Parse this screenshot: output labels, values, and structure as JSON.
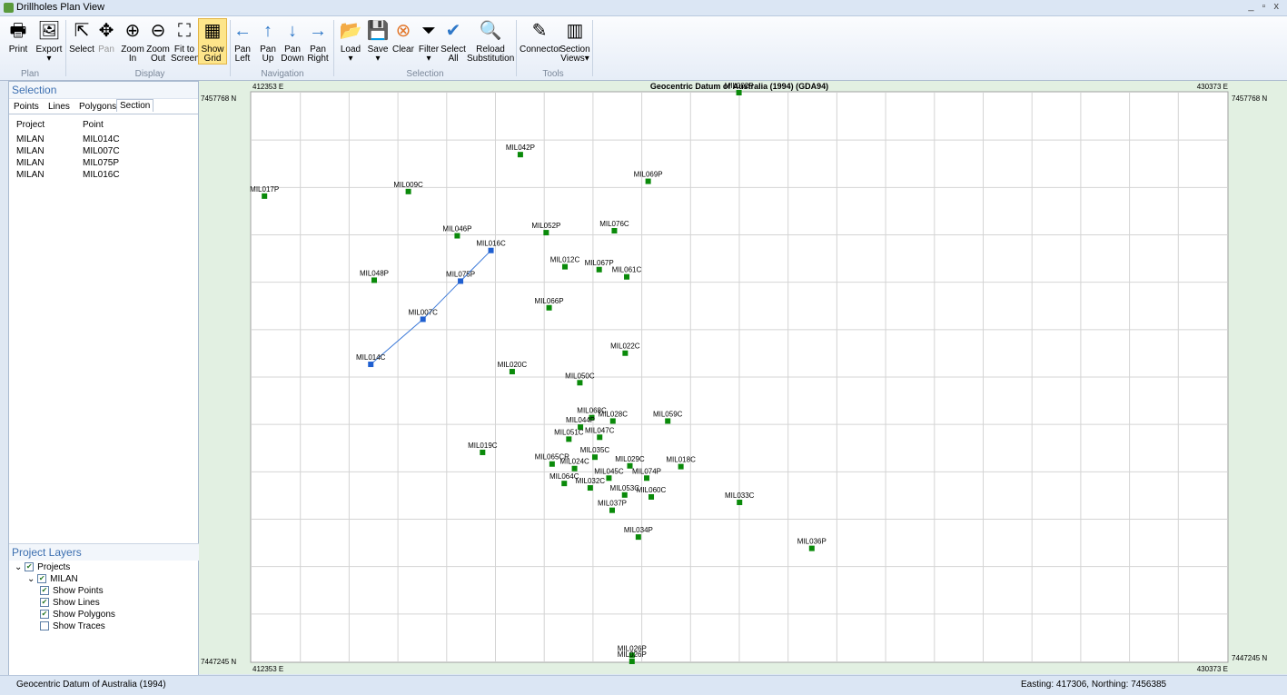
{
  "window": {
    "title": "Drillholes Plan View",
    "controls": "_ ▫ x"
  },
  "ribbon": {
    "buttons": [
      {
        "id": "print",
        "label": "Print",
        "icon": "🖶"
      },
      {
        "id": "export",
        "label": "Export\n▾",
        "icon": "🖼"
      },
      {
        "id": "select",
        "label": "Select",
        "icon": "⇱"
      },
      {
        "id": "pan",
        "label": "Pan",
        "icon": "✥"
      },
      {
        "id": "zoom_in",
        "label": "Zoom\nIn",
        "icon": "⊕"
      },
      {
        "id": "zoom_out",
        "label": "Zoom\nOut",
        "icon": "⊖"
      },
      {
        "id": "fit",
        "label": "Fit to\nScreen",
        "icon": "⛶"
      },
      {
        "id": "grid",
        "label": "Show\nGrid",
        "icon": "▦"
      },
      {
        "id": "pan_left",
        "label": "Pan\nLeft",
        "icon": "←"
      },
      {
        "id": "pan_up",
        "label": "Pan\nUp",
        "icon": "↑"
      },
      {
        "id": "pan_down",
        "label": "Pan\nDown",
        "icon": "↓"
      },
      {
        "id": "pan_right",
        "label": "Pan\nRight",
        "icon": "→"
      },
      {
        "id": "load",
        "label": "Load\n▾",
        "icon": "📂"
      },
      {
        "id": "save",
        "label": "Save\n▾",
        "icon": "💾"
      },
      {
        "id": "clear",
        "label": "Clear",
        "icon": "⊗"
      },
      {
        "id": "filter",
        "label": "Filter\n▾",
        "icon": "⏷"
      },
      {
        "id": "select_all",
        "label": "Select\nAll",
        "icon": "✔"
      },
      {
        "id": "reload",
        "label": "Reload\nSubstitution",
        "icon": "🔍"
      },
      {
        "id": "connector",
        "label": "Connector",
        "icon": "✎"
      },
      {
        "id": "section",
        "label": "Section\nViews▾",
        "icon": "▥"
      }
    ],
    "groups": [
      "Plan",
      "Display",
      "Navigation",
      "Selection",
      "Tools"
    ]
  },
  "selection": {
    "title": "Selection",
    "tabs": [
      "Points",
      "Lines",
      "Polygons",
      "Section"
    ],
    "columns": [
      "Project",
      "Point"
    ],
    "rows": [
      [
        "MILAN",
        "MIL014C"
      ],
      [
        "MILAN",
        "MIL007C"
      ],
      [
        "MILAN",
        "MIL075P"
      ],
      [
        "MILAN",
        "MIL016C"
      ]
    ]
  },
  "layers": {
    "title": "Project Layers",
    "items": [
      {
        "label": "Projects",
        "checked": true,
        "level": 0,
        "expander": true
      },
      {
        "label": "MILAN",
        "checked": true,
        "level": 1,
        "expander": true
      },
      {
        "label": "Show Points",
        "checked": true,
        "level": 2
      },
      {
        "label": "Show Lines",
        "checked": true,
        "level": 2
      },
      {
        "label": "Show Polygons",
        "checked": true,
        "level": 2
      },
      {
        "label": "Show Traces",
        "checked": false,
        "level": 2
      }
    ]
  },
  "map": {
    "datum_title": "Geocentric Datum of Australia (1994) (GDA94)",
    "easting_min_label": "412353 E",
    "easting_max_label": "430373 E",
    "northing_max_label": "7457768 N",
    "northing_min_label": "7447245 N",
    "easting_range": [
      412353,
      430373
    ],
    "northing_range": [
      7447245,
      7457768
    ],
    "point_color": "#0a8a0a",
    "selected_color": "#1f5fd0",
    "line_color": "#3a78d8",
    "section_line": [
      "MIL014C",
      "MIL007C",
      "MIL075P",
      "MIL016C"
    ],
    "points": [
      {
        "name": "MIL002P",
        "e": 421356,
        "n": 7457768
      },
      {
        "name": "MIL042P",
        "e": 417318,
        "n": 7456622
      },
      {
        "name": "MIL069P",
        "e": 419679,
        "n": 7456128
      },
      {
        "name": "MIL017P",
        "e": 412591,
        "n": 7455854
      },
      {
        "name": "MIL009C",
        "e": 415249,
        "n": 7455939
      },
      {
        "name": "MIL076C",
        "e": 419055,
        "n": 7455213
      },
      {
        "name": "MIL052P",
        "e": 417795,
        "n": 7455178
      },
      {
        "name": "MIL046P",
        "e": 416152,
        "n": 7455120
      },
      {
        "name": "MIL016C",
        "e": 416775,
        "n": 7454848,
        "selected": true
      },
      {
        "name": "MIL012C",
        "e": 418142,
        "n": 7454547
      },
      {
        "name": "MIL067P",
        "e": 418774,
        "n": 7454494
      },
      {
        "name": "MIL061C",
        "e": 419283,
        "n": 7454360
      },
      {
        "name": "MIL048P",
        "e": 414618,
        "n": 7454298
      },
      {
        "name": "MIL075P",
        "e": 416213,
        "n": 7454281,
        "selected": true
      },
      {
        "name": "MIL066P",
        "e": 417849,
        "n": 7453788
      },
      {
        "name": "MIL007C",
        "e": 415519,
        "n": 7453575,
        "selected": true
      },
      {
        "name": "MIL022C",
        "e": 419255,
        "n": 7452948
      },
      {
        "name": "MIL014C",
        "e": 414555,
        "n": 7452741,
        "selected": true
      },
      {
        "name": "MIL020C",
        "e": 417167,
        "n": 7452607
      },
      {
        "name": "MIL050C",
        "e": 418417,
        "n": 7452401
      },
      {
        "name": "MIL028C",
        "e": 419027,
        "n": 7451692
      },
      {
        "name": "MIL059C",
        "e": 420041,
        "n": 7451692
      },
      {
        "name": "MIL068C",
        "e": 418637,
        "n": 7451755
      },
      {
        "name": "MIL044P",
        "e": 418428,
        "n": 7451580
      },
      {
        "name": "MIL047C",
        "e": 418783,
        "n": 7451392
      },
      {
        "name": "MIL051C",
        "e": 418214,
        "n": 7451357
      },
      {
        "name": "MIL019C",
        "e": 416620,
        "n": 7451112
      },
      {
        "name": "MIL035C",
        "e": 418695,
        "n": 7451024
      },
      {
        "name": "MIL065CR",
        "e": 417904,
        "n": 7450897
      },
      {
        "name": "MIL024C",
        "e": 418319,
        "n": 7450813
      },
      {
        "name": "MIL029C",
        "e": 419341,
        "n": 7450863
      },
      {
        "name": "MIL018C",
        "e": 420283,
        "n": 7450849
      },
      {
        "name": "MIL045C",
        "e": 418954,
        "n": 7450636
      },
      {
        "name": "MIL074P",
        "e": 419652,
        "n": 7450636
      },
      {
        "name": "MIL064C",
        "e": 418129,
        "n": 7450537
      },
      {
        "name": "MIL032C",
        "e": 418609,
        "n": 7450455
      },
      {
        "name": "MIL053C",
        "e": 419245,
        "n": 7450324
      },
      {
        "name": "MIL060C",
        "e": 419736,
        "n": 7450288
      },
      {
        "name": "MIL033C",
        "e": 421367,
        "n": 7450187
      },
      {
        "name": "MIL037P",
        "e": 419014,
        "n": 7450041
      },
      {
        "name": "MIL034P",
        "e": 419498,
        "n": 7449546
      },
      {
        "name": "MIL036P",
        "e": 422702,
        "n": 7449336
      },
      {
        "name": "MIL026P",
        "e": 419380,
        "n": 7447358
      },
      {
        "name": "MIL026P",
        "e": 419380,
        "n": 7447245
      }
    ]
  },
  "status": {
    "datum": "Geocentric Datum of Australia (1994)",
    "coords": "Easting: 417306, Northing: 7456385"
  }
}
